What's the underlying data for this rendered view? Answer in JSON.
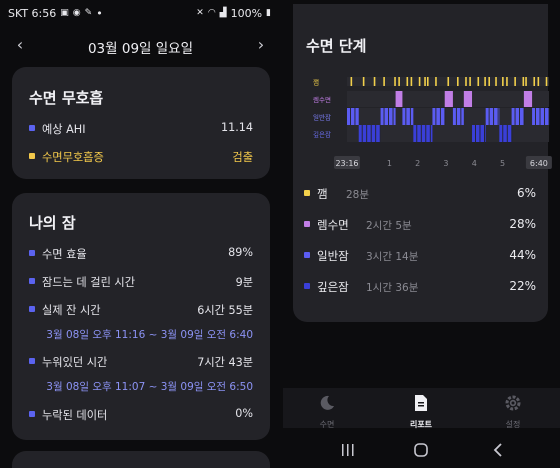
{
  "status": {
    "carrier_time": "SKT 6:56",
    "dot": "•",
    "battery": "100%"
  },
  "date_nav": {
    "prev": "‹",
    "date": "03월 09일 일요일",
    "next": "›"
  },
  "apnea_card": {
    "title": "수면 무호흡",
    "rows": [
      {
        "label": "예상 AHI",
        "value": "11.14"
      },
      {
        "label": "수면무호흡증",
        "value": "검출"
      }
    ]
  },
  "sleep_card": {
    "title": "나의 잠",
    "efficiency": {
      "label": "수면 효율",
      "value": "89%"
    },
    "latency": {
      "label": "잠드는 데 걸린 시간",
      "value": "9분"
    },
    "actual": {
      "label": "실제 잔 시간",
      "value": "6시간 55분",
      "range": "3월 08일 오후 11:16 ~ 3월 09일 오전 6:40"
    },
    "in_bed": {
      "label": "누워있던 시간",
      "value": "7시간 43분",
      "range": "3월 08일 오후 11:07 ~ 3월 09일 오전 6:50"
    },
    "missing": {
      "label": "누락된 데이터",
      "value": "0%"
    }
  },
  "stages_card": {
    "title": "수면 단계",
    "chart_data": {
      "type": "hypnogram",
      "stage_labels": [
        "깸",
        "렘수면",
        "일반잠",
        "깊은잠"
      ],
      "colors": {
        "awake": "#f2d04b",
        "rem": "#c17ee6",
        "light": "#5b5cf2",
        "deep": "#3a3fd8"
      },
      "x_ticks": [
        "23:16",
        "1",
        "2",
        "3",
        "4",
        "5",
        "6:40"
      ],
      "x_range_hours": [
        23.27,
        30.67
      ],
      "segments": [
        {
          "stage": "light",
          "start": 23.27,
          "end": 23.7
        },
        {
          "stage": "deep",
          "start": 23.7,
          "end": 24.5
        },
        {
          "stage": "light",
          "start": 24.5,
          "end": 25.05
        },
        {
          "stage": "rem",
          "start": 25.05,
          "end": 25.3
        },
        {
          "stage": "light",
          "start": 25.3,
          "end": 25.7
        },
        {
          "stage": "deep",
          "start": 25.7,
          "end": 26.4
        },
        {
          "stage": "light",
          "start": 26.4,
          "end": 26.85
        },
        {
          "stage": "rem",
          "start": 26.85,
          "end": 27.15
        },
        {
          "stage": "light",
          "start": 27.15,
          "end": 27.55
        },
        {
          "stage": "rem",
          "start": 27.55,
          "end": 27.85
        },
        {
          "stage": "deep",
          "start": 27.85,
          "end": 28.35
        },
        {
          "stage": "light",
          "start": 28.35,
          "end": 28.85
        },
        {
          "stage": "deep",
          "start": 28.85,
          "end": 29.3
        },
        {
          "stage": "light",
          "start": 29.3,
          "end": 29.75
        },
        {
          "stage": "rem",
          "start": 29.75,
          "end": 30.05
        },
        {
          "stage": "light",
          "start": 30.05,
          "end": 30.67
        }
      ],
      "awake_marks": [
        23.4,
        23.85,
        24.25,
        24.6,
        25.0,
        25.15,
        25.45,
        25.6,
        25.9,
        26.1,
        26.2,
        26.5,
        26.95,
        27.3,
        27.6,
        27.75,
        28.05,
        28.3,
        28.45,
        28.7,
        28.95,
        29.1,
        29.4,
        29.7,
        29.8,
        30.1,
        30.25,
        30.55
      ]
    },
    "stages": [
      {
        "name": "깸",
        "duration": "28분",
        "percent": "6%"
      },
      {
        "name": "렘수면",
        "duration": "2시간 5분",
        "percent": "28%"
      },
      {
        "name": "일반잠",
        "duration": "3시간 14분",
        "percent": "44%"
      },
      {
        "name": "깊은잠",
        "duration": "1시간 36분",
        "percent": "22%"
      }
    ]
  },
  "bottom_nav": {
    "items": [
      {
        "label": "수면"
      },
      {
        "label": "리포트"
      },
      {
        "label": "설정"
      }
    ]
  }
}
